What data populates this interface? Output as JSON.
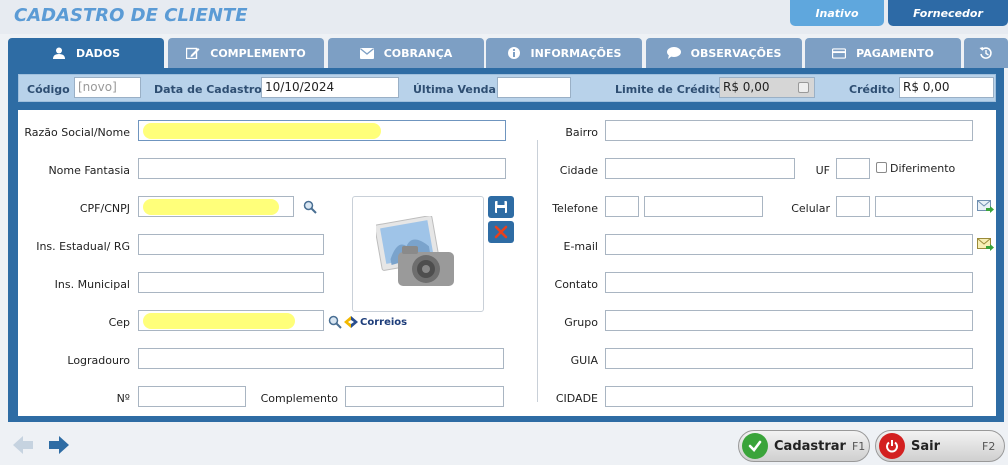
{
  "window": {
    "title": "CADASTRO DE CLIENTE"
  },
  "top_buttons": {
    "inativo": "Inativo",
    "fornecedor": "Fornecedor"
  },
  "tabs": [
    {
      "label": "DADOS",
      "icon": "user-icon"
    },
    {
      "label": "COMPLEMENTO",
      "icon": "edit-icon"
    },
    {
      "label": "COBRANÇA",
      "icon": "envelope-icon"
    },
    {
      "label": "INFORMAÇÕES",
      "icon": "info-icon"
    },
    {
      "label": "OBSERVAÇÕES",
      "icon": "comment-icon"
    },
    {
      "label": "PAGAMENTO",
      "icon": "credit-card-icon"
    }
  ],
  "header_fields": {
    "codigo_label": "Código",
    "codigo_placeholder": "[novo]",
    "data_cadastro_label": "Data de Cadastro",
    "data_cadastro_value": "10/10/2024",
    "ultima_venda_label": "Última Venda",
    "ultima_venda_value": "",
    "limite_credito_label": "Limite de Crédito",
    "limite_credito_value": "R$ 0,00",
    "credito_label": "Crédito",
    "credito_value": "R$ 0,00"
  },
  "left_fields": {
    "razao_social": "Razão Social/Nome",
    "nome_fantasia": "Nome Fantasia",
    "cpf_cnpj": "CPF/CNPJ",
    "ins_estadual": "Ins. Estadual/ RG",
    "ins_municipal": "Ins. Municipal",
    "cep": "Cep",
    "logradouro": "Logradouro",
    "numero": "Nº",
    "complemento": "Complemento",
    "correios_label": "Correios"
  },
  "right_fields": {
    "bairro": "Bairro",
    "cidade": "Cidade",
    "uf": "UF",
    "diferimento": "Diferimento",
    "telefone": "Telefone",
    "celular": "Celular",
    "email": "E-mail",
    "contato": "Contato",
    "grupo": "Grupo",
    "guia": "GUIA",
    "cidade2": "CIDADE"
  },
  "actions": {
    "cadastrar_label": "Cadastrar",
    "cadastrar_key": "F1",
    "sair_label": "Sair",
    "sair_key": "F2"
  },
  "colors": {
    "primary": "#2e6ca4",
    "tab_inactive": "#7d9fc4",
    "title": "#5b9bd5",
    "highlight": "#ffff7a"
  }
}
